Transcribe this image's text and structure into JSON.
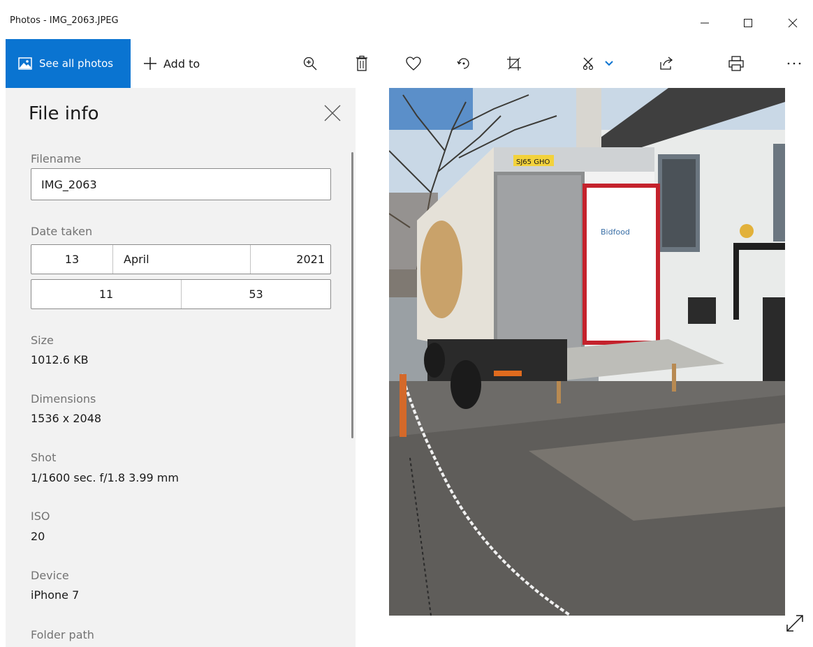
{
  "window": {
    "title": "Photos - IMG_2063.JPEG"
  },
  "toolbar": {
    "see_all_photos": "See all photos",
    "add_to": "Add to"
  },
  "file_info": {
    "title": "File info",
    "filename_label": "Filename",
    "filename_value": "IMG_2063",
    "date_label": "Date taken",
    "date_day": "13",
    "date_month": "April",
    "date_year": "2021",
    "time_hour": "11",
    "time_minute": "53",
    "size_label": "Size",
    "size_value": "1012.6 KB",
    "dimensions_label": "Dimensions",
    "dimensions_value": "1536 x 2048",
    "shot_label": "Shot",
    "shot_value": "1/1600 sec. f/1.8 3.99 mm",
    "iso_label": "ISO",
    "iso_value": "20",
    "device_label": "Device",
    "device_value": "iPhone 7",
    "folder_label": "Folder path"
  },
  "photo": {
    "plate": "SJ65 GHO",
    "brand": "Bidfood"
  },
  "colors": {
    "accent": "#0a74d1",
    "panel_bg": "#f2f2f2"
  }
}
